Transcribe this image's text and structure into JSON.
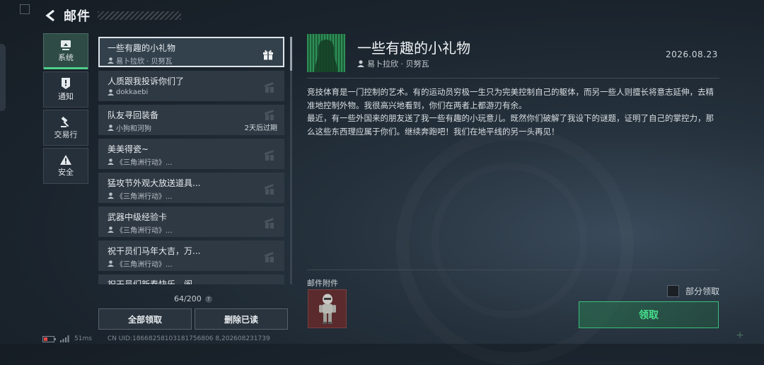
{
  "header": {
    "title": "邮件"
  },
  "categories": [
    {
      "label": "系统",
      "icon": "system-icon"
    },
    {
      "label": "通知",
      "icon": "notice-icon"
    },
    {
      "label": "交易行",
      "icon": "hammer-icon"
    },
    {
      "label": "安全",
      "icon": "warning-icon"
    }
  ],
  "mails": [
    {
      "title": "一些有趣的小礼物",
      "sender": "易卜拉欣 · 贝努瓦"
    },
    {
      "title": "人质跟我投诉你们了",
      "sender": "dokkaebi"
    },
    {
      "title": "队友寻回装备",
      "sender": "小狗和河狗",
      "expiry": "2天后过期"
    },
    {
      "title": "美美得瓷~",
      "sender": "《三角洲行动》..."
    },
    {
      "title": "猛攻节外观大放送道具...",
      "sender": "《三角洲行动》..."
    },
    {
      "title": "武器中级经验卡",
      "sender": "《三角洲行动》..."
    },
    {
      "title": "祝干员们马年大吉，万...",
      "sender": "《三角洲行动》..."
    },
    {
      "title": "祝干员们新春快乐，阖",
      "sender": ""
    }
  ],
  "list_footer": {
    "count": "64/200",
    "help": "?"
  },
  "buttons": {
    "claim_all": "全部领取",
    "delete_read": "删除已读"
  },
  "status_bar": {
    "ping": "51ms",
    "uid": "CN UID:18668258103181756806 8,202608231739"
  },
  "detail": {
    "title": "一些有趣的小礼物",
    "sender": "易卜拉欣 · 贝努瓦",
    "date": "2026.08.23",
    "body_p1": "竞技体育是一门控制的艺术。有的运动员穷极一生只为完美控制自己的躯体，而另一些人则擅长将意志延伸，去精准地控制外物。我很高兴地看到，你们在两者上都游刃有余。",
    "body_p2": "最近，有一些外国来的朋友送了我一些有趣的小玩意儿。既然你们破解了我设下的谜题，证明了自己的掌控力，那么这些东西理应属于你们。继续奔跑吧！我们在地平线的另一头再见！"
  },
  "attachments": {
    "label": "邮件附件",
    "partial_claim": "部分领取",
    "claim": "领取"
  },
  "colors": {
    "accent_green": "#46e08d",
    "attachment_bg": "#5a2a2c"
  }
}
